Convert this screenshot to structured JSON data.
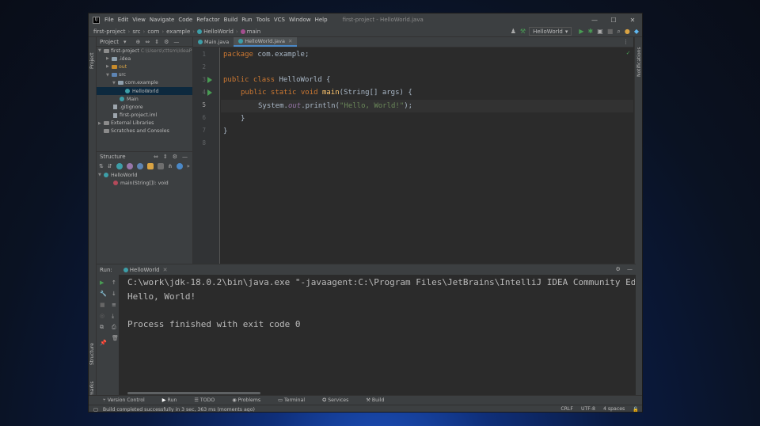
{
  "window": {
    "title": "first-project - HelloWorld.java",
    "app_logo": "IJ",
    "menu": [
      "File",
      "Edit",
      "View",
      "Navigate",
      "Code",
      "Refactor",
      "Build",
      "Run",
      "Tools",
      "VCS",
      "Window",
      "Help"
    ]
  },
  "breadcrumb": [
    "first-project",
    "src",
    "com",
    "example",
    "HelloWorld",
    "main"
  ],
  "run_config": "HelloWorld",
  "left_strip": {
    "project": "Project",
    "structure": "Structure",
    "bookmarks": "Bookmarks"
  },
  "right_strip": {
    "notifications": "Notifications"
  },
  "project_panel": {
    "title": "Project",
    "tree": [
      {
        "label": "first-project",
        "extra": "C:\\Users\\cttsm\\IdeaP"
      },
      {
        "label": ".idea"
      },
      {
        "label": "out"
      },
      {
        "label": "src"
      },
      {
        "label": "com.example"
      },
      {
        "label": "HelloWorld"
      },
      {
        "label": "Main"
      },
      {
        "label": ".gitignore"
      },
      {
        "label": "first-project.iml"
      },
      {
        "label": "External Libraries"
      },
      {
        "label": "Scratches and Consoles"
      }
    ]
  },
  "structure_panel": {
    "title": "Structure",
    "items": [
      {
        "label": "HelloWorld"
      },
      {
        "label": "main(String[]): void"
      }
    ]
  },
  "tabs": [
    {
      "label": "Main.java"
    },
    {
      "label": "HelloWorld.java"
    }
  ],
  "editor": {
    "line_numbers": [
      "1",
      "2",
      "3",
      "4",
      "5",
      "6",
      "7",
      "8"
    ],
    "kw_package": "package",
    "pkg": " com.example;",
    "kw_public_class": "public class",
    "class_name": " HelloWorld {",
    "kw_public_static_void": "public static void",
    "method_name": "main",
    "method_params": "(String[] args) {",
    "sys": "System.",
    "out": "out",
    "println": ".println(",
    "str": "\"Hello, World!\"",
    "end": ");",
    "close_inner": "}",
    "close_outer": "}"
  },
  "run_panel": {
    "label": "Run:",
    "tab": "HelloWorld",
    "console": [
      "C:\\work\\jdk-18.0.2\\bin\\java.exe \"-javaagent:C:\\Program Files\\JetBrains\\IntelliJ IDEA Community Ed:",
      "Hello, World!",
      "Process finished with exit code 0"
    ]
  },
  "bottom_tabs": [
    "Version Control",
    "Run",
    "TODO",
    "Problems",
    "Terminal",
    "Services",
    "Build"
  ],
  "status": {
    "message": "Build completed successfully in 3 sec, 363 ms (moments ago)",
    "line_sep": "CRLF",
    "encoding": "UTF-8",
    "indent": "4 spaces"
  },
  "colors": {
    "keyword": "#cc7832",
    "method": "#ffc66d",
    "string": "#6a8759",
    "static_field": "#9876aa",
    "run_green": "#499c54"
  }
}
